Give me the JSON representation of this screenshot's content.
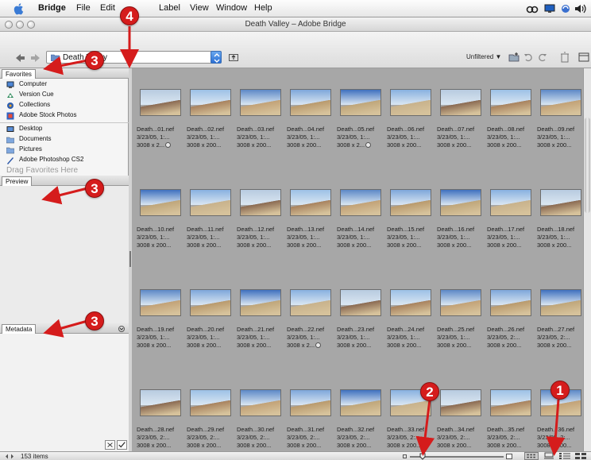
{
  "menubar": {
    "app_name": "Bridge",
    "items": [
      "File",
      "Edit",
      "Label",
      "View",
      "Window",
      "Help"
    ]
  },
  "window": {
    "title": "Death Valley – Adobe Bridge"
  },
  "toolbar": {
    "path_value": "Death Valley",
    "filter_label": "Unfiltered ▼"
  },
  "favorites": {
    "tab_label": "Favorites",
    "items": [
      {
        "label": "Computer",
        "icon": "computer-icon"
      },
      {
        "label": "Version Cue",
        "icon": "version-cue-icon"
      },
      {
        "label": "Collections",
        "icon": "collections-icon"
      },
      {
        "label": "Adobe Stock Photos",
        "icon": "stock-photos-icon"
      },
      {
        "label": "Desktop",
        "icon": "desktop-icon"
      },
      {
        "label": "Documents",
        "icon": "documents-folder-icon"
      },
      {
        "label": "Pictures",
        "icon": "pictures-folder-icon"
      },
      {
        "label": "Adobe Photoshop CS2",
        "icon": "photoshop-icon"
      }
    ],
    "drag_hint": "Drag Favorites Here"
  },
  "preview": {
    "tab_label": "Preview"
  },
  "metadata": {
    "tab_label": "Metadata"
  },
  "thumbnails": [
    {
      "name": "Death...01.nef",
      "date": "3/23/05, 1:...",
      "size": "3008 x 2...",
      "badge": true
    },
    {
      "name": "Death...02.nef",
      "date": "3/23/05, 1:...",
      "size": "3008 x 200..."
    },
    {
      "name": "Death...03.nef",
      "date": "3/23/05, 1:...",
      "size": "3008 x 200..."
    },
    {
      "name": "Death...04.nef",
      "date": "3/23/05, 1:...",
      "size": "3008 x 200..."
    },
    {
      "name": "Death...05.nef",
      "date": "3/23/05, 1:...",
      "size": "3008 x 2...",
      "badge": true
    },
    {
      "name": "Death...06.nef",
      "date": "3/23/05, 1:...",
      "size": "3008 x 200..."
    },
    {
      "name": "Death...07.nef",
      "date": "3/23/05, 1:...",
      "size": "3008 x 200..."
    },
    {
      "name": "Death...08.nef",
      "date": "3/23/05, 1:...",
      "size": "3008 x 200..."
    },
    {
      "name": "Death...09.nef",
      "date": "3/23/05, 1:...",
      "size": "3008 x 200..."
    },
    {
      "name": "Death...10.nef",
      "date": "3/23/05, 1:...",
      "size": "3008 x 200..."
    },
    {
      "name": "Death...11.nef",
      "date": "3/23/05, 1:...",
      "size": "3008 x 200..."
    },
    {
      "name": "Death...12.nef",
      "date": "3/23/05, 1:...",
      "size": "3008 x 200..."
    },
    {
      "name": "Death...13.nef",
      "date": "3/23/05, 1:...",
      "size": "3008 x 200..."
    },
    {
      "name": "Death...14.nef",
      "date": "3/23/05, 1:...",
      "size": "3008 x 200..."
    },
    {
      "name": "Death...15.nef",
      "date": "3/23/05, 1:...",
      "size": "3008 x 200..."
    },
    {
      "name": "Death...16.nef",
      "date": "3/23/05, 1:...",
      "size": "3008 x 200..."
    },
    {
      "name": "Death...17.nef",
      "date": "3/23/05, 1:...",
      "size": "3008 x 200..."
    },
    {
      "name": "Death...18.nef",
      "date": "3/23/05, 1:...",
      "size": "3008 x 200..."
    },
    {
      "name": "Death...19.nef",
      "date": "3/23/05, 1:...",
      "size": "3008 x 200..."
    },
    {
      "name": "Death...20.nef",
      "date": "3/23/05, 1:...",
      "size": "3008 x 200..."
    },
    {
      "name": "Death...21.nef",
      "date": "3/23/05, 1:...",
      "size": "3008 x 200..."
    },
    {
      "name": "Death...22.nef",
      "date": "3/23/05, 1:...",
      "size": "3008 x 2...",
      "badge": true
    },
    {
      "name": "Death...23.nef",
      "date": "3/23/05, 1:...",
      "size": "3008 x 200..."
    },
    {
      "name": "Death...24.nef",
      "date": "3/23/05, 1:...",
      "size": "3008 x 200..."
    },
    {
      "name": "Death...25.nef",
      "date": "3/23/05, 1:...",
      "size": "3008 x 200..."
    },
    {
      "name": "Death...26.nef",
      "date": "3/23/05, 2:...",
      "size": "3008 x 200..."
    },
    {
      "name": "Death...27.nef",
      "date": "3/23/05, 2:...",
      "size": "3008 x 200..."
    },
    {
      "name": "Death...28.nef",
      "date": "3/23/05, 2:...",
      "size": "3008 x 200..."
    },
    {
      "name": "Death...29.nef",
      "date": "3/23/05, 2:...",
      "size": "3008 x 200..."
    },
    {
      "name": "Death...30.nef",
      "date": "3/23/05, 2:...",
      "size": "3008 x 200..."
    },
    {
      "name": "Death...31.nef",
      "date": "3/23/05, 2:...",
      "size": "3008 x 200..."
    },
    {
      "name": "Death...32.nef",
      "date": "3/23/05, 2:...",
      "size": "3008 x 200..."
    },
    {
      "name": "Death...33.nef",
      "date": "3/23/05, 2:...",
      "size": "3008 x 200..."
    },
    {
      "name": "Death...34.nef",
      "date": "3/23/05, 2:...",
      "size": "3008 x 200..."
    },
    {
      "name": "Death...35.nef",
      "date": "3/23/05, 2:...",
      "size": "3008 x 200..."
    },
    {
      "name": "Death...36.nef",
      "date": "3/23/05, 2:...",
      "size": "3008 x 200..."
    }
  ],
  "statusbar": {
    "item_count": "153 items"
  },
  "callouts": [
    "4",
    "3",
    "3",
    "3",
    "2",
    "1"
  ],
  "colors": {
    "callout": "#d51c1c",
    "content_bg": "#a7a7a7"
  }
}
